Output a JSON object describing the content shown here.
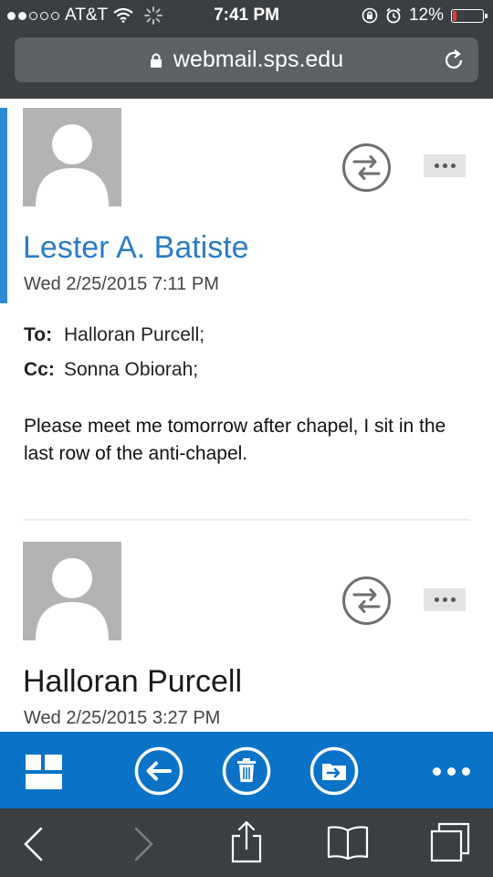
{
  "status_bar": {
    "carrier": "AT&T",
    "time": "7:41 PM",
    "battery": "12%",
    "battery_level": 0.12,
    "signal_bars_filled": 2,
    "signal_bars_total": 5
  },
  "browser": {
    "url": "webmail.sps.edu"
  },
  "messages": [
    {
      "sender": "Lester A. Batiste",
      "date": "Wed 2/25/2015 7:11 PM",
      "to_label": "To:",
      "to": "Halloran Purcell;",
      "cc_label": "Cc:",
      "cc": "Sonna Obiorah;",
      "body": "Please meet me tomorrow after chapel, I sit in the last row of the anti-chapel."
    },
    {
      "sender": "Halloran Purcell",
      "date": "Wed 2/25/2015 3:27 PM"
    }
  ],
  "colors": {
    "accent": "#0a72c7",
    "selected_sender": "#2a7cc5",
    "chrome": "#3b3e42",
    "battery_low": "#e53b30"
  },
  "toolbar_icons": [
    "tiles-icon",
    "back-arrow-icon",
    "trash-icon",
    "move-folder-icon",
    "more-icon"
  ],
  "safari_icons": [
    "back-chevron-icon",
    "forward-chevron-icon",
    "share-icon",
    "bookmarks-icon",
    "tabs-icon"
  ]
}
